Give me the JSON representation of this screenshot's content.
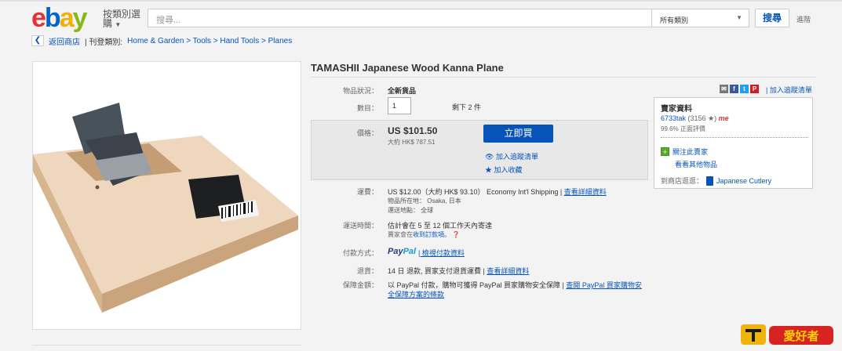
{
  "header": {
    "logo": [
      "e",
      "b",
      "a",
      "y"
    ],
    "shop_by": "按類別選購",
    "search_placeholder": "搜尋...",
    "category": "所有類別",
    "search_button": "搜尋",
    "advanced": "進階"
  },
  "breadcrumb": {
    "back": "返回商店",
    "listed_in": "| 刊登類別:",
    "path": "Home & Garden > Tools > Hand Tools > Planes"
  },
  "item": {
    "title": "TAMASHII Japanese Wood Kanna Plane",
    "condition_label": "物品狀況：",
    "condition": "全新貨品",
    "qty_label": "數目：",
    "qty": "1",
    "qty_left": "剩下 2 件",
    "price_label": "價格：",
    "price": "US $101.50",
    "price_approx": "大約 HK$ 787.51",
    "buy_now": "立即買",
    "add_watch": "加入追蹤清單",
    "add_collection": "加入收藏",
    "shipping_label": "運費：",
    "shipping": "US $12.00（大約 HK$ 93.10） Economy Int'l Shipping |",
    "shipping_details": "查看詳細資料",
    "item_location": "物品所在地： Osaka, 日本",
    "ships_to": "運送地點： 全球",
    "delivery_label": "運送時間：",
    "delivery": "估計會在 5 至 12 個工作天內寄達",
    "delivery_note_a": "賣家會在",
    "delivery_note_b": "收到訂款項",
    "delivery_note_c": "。 ❓",
    "payment_label": "付款方式：",
    "paypal_a": "Pay",
    "paypal_b": "Pal",
    "payment_details": "| 檢視付款資料",
    "returns_label": "退貨：",
    "returns": "14 日 退款, 買家支付退貨運費 |",
    "returns_details": "查看詳細資料",
    "guarantee_label": "保障金額：",
    "guarantee": "以 PayPal 付款，購物可獲得 PayPal 買家購物安全保障 |",
    "guarantee_link1": "查閱 PayPal 買家購物安",
    "guarantee_link2": "全保障方案的條款"
  },
  "seller": {
    "watch_top": "| 加入追蹤清單",
    "title": "賣家資料",
    "name": "6733tak",
    "feedback_count": "(3156 ★)",
    "me": "me",
    "positive": "99.6% 正面評價",
    "follow": "關注此賣家",
    "other_items": "看看其他物品",
    "store_label": "到商店逛逛：",
    "store_name": "Japanese Cutlery"
  },
  "colors": {
    "accent": "#0654ba",
    "ebay_red": "#e53238",
    "ebay_blue": "#0064d2",
    "ebay_yellow": "#f5af02",
    "ebay_green": "#86b817"
  },
  "watermark": "愛好者"
}
